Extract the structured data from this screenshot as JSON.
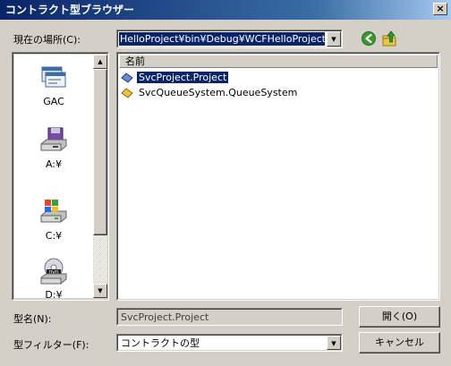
{
  "window": {
    "title": "コントラクト型ブラウザー"
  },
  "location": {
    "label": "現在の場所(C):",
    "path": "HelloProject¥bin¥Debug¥WCFHelloProject.exe"
  },
  "places": [
    {
      "label": "GAC",
      "icon": "gac-icon"
    },
    {
      "label": "A:¥",
      "icon": "floppy-drive-icon"
    },
    {
      "label": "C:¥",
      "icon": "hard-drive-icon"
    },
    {
      "label": "D:¥",
      "icon": "dvd-drive-icon"
    }
  ],
  "list": {
    "header": "名前",
    "items": [
      {
        "label": "SvcProject.Project",
        "selected": true
      },
      {
        "label": "SvcQueueSystem.QueueSystem",
        "selected": false
      }
    ]
  },
  "typename": {
    "label": "型名(N):",
    "value": "SvcProject.Project"
  },
  "filter": {
    "label": "型フィルター(F):",
    "value": "コントラクトの型"
  },
  "buttons": {
    "open": "開く(O)",
    "cancel": "キャンセル",
    "close": "×"
  },
  "colors": {
    "selection": "#0a246a",
    "dialog": "#d4d0c8",
    "title_start": "#0a246a",
    "title_end": "#a6caf0"
  }
}
